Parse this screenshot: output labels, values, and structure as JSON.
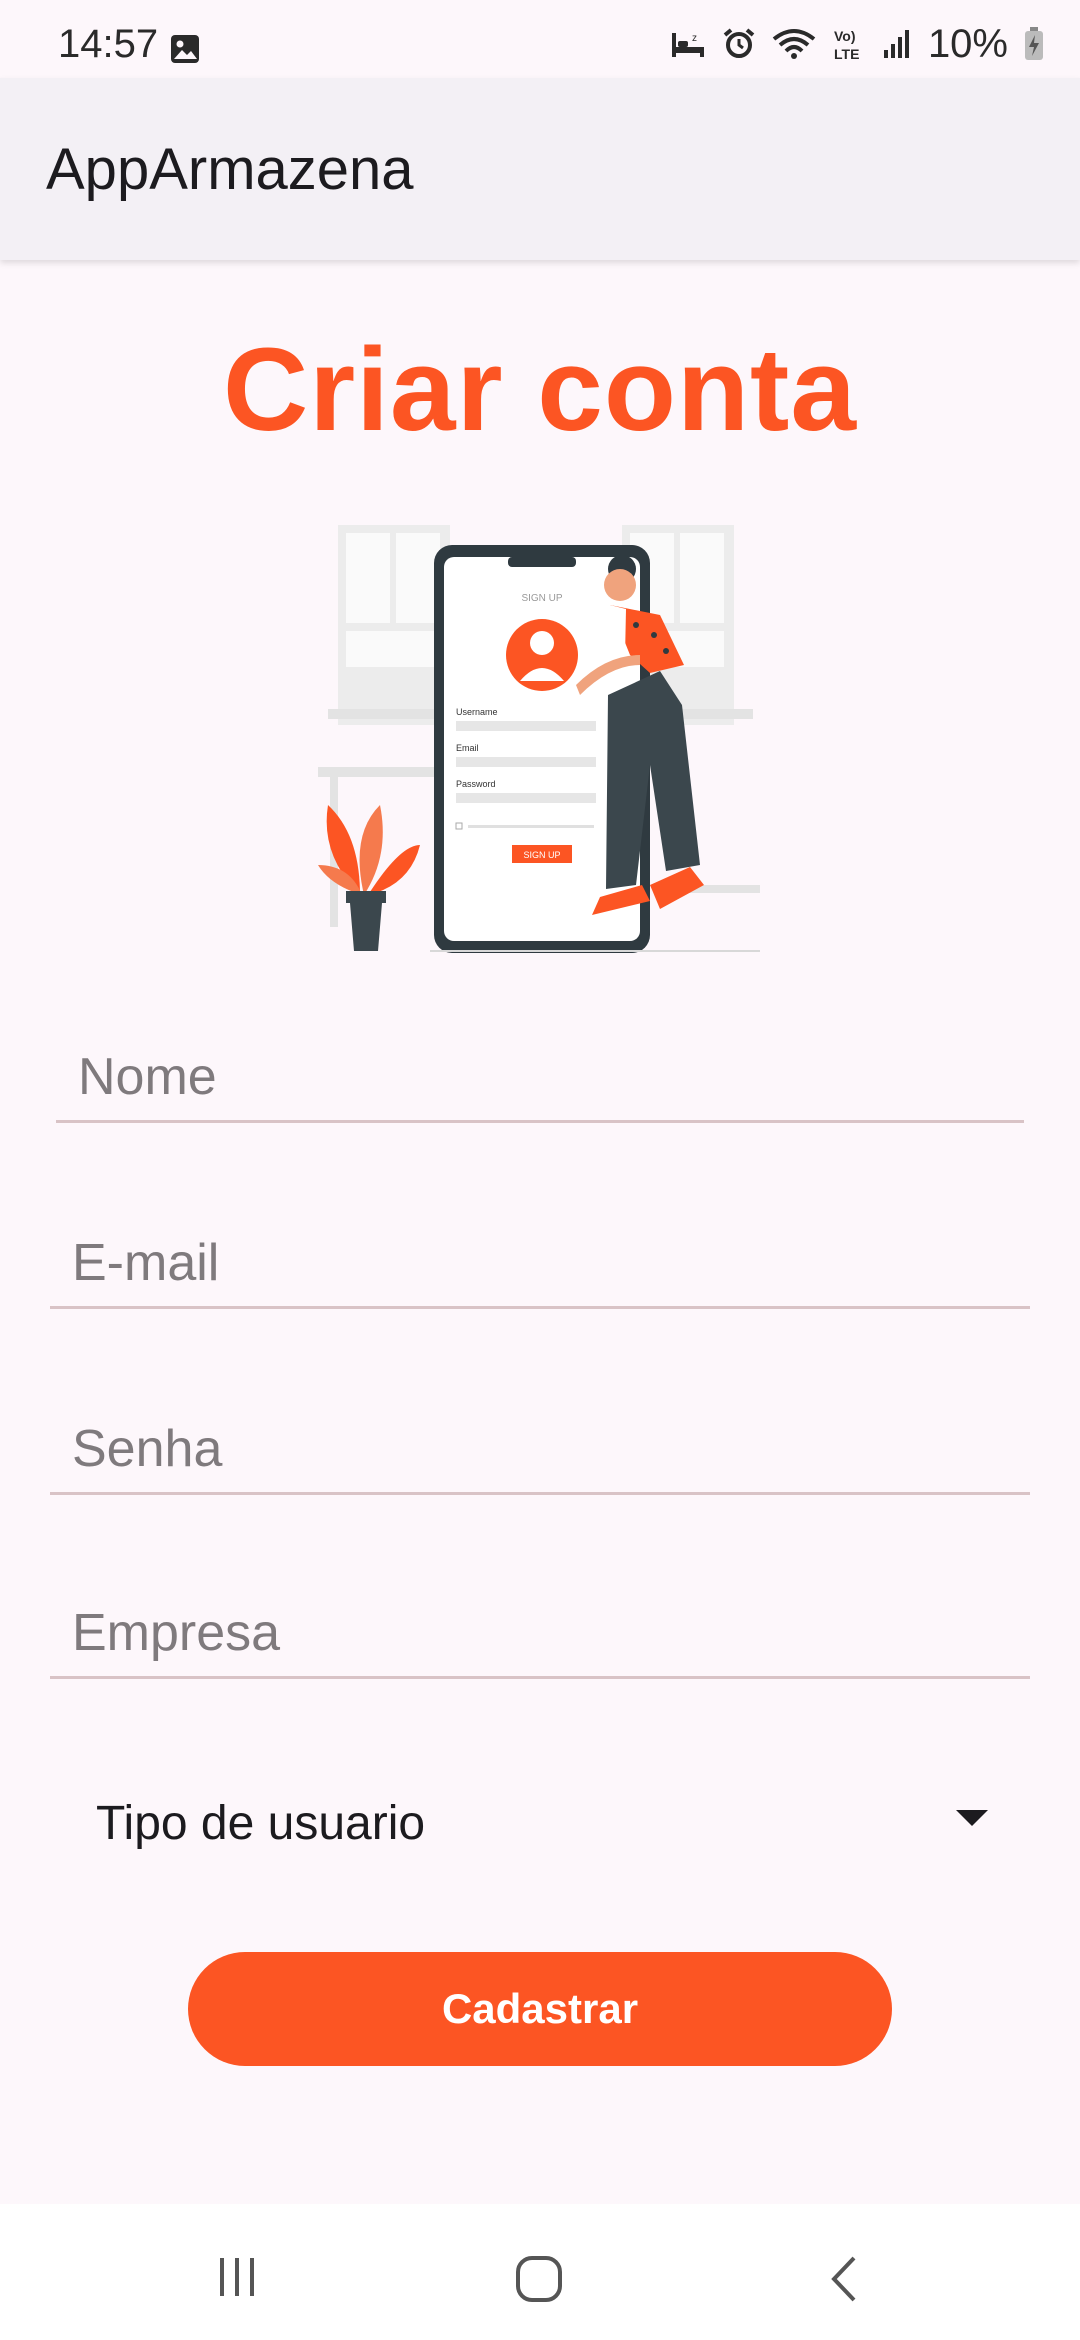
{
  "status_bar": {
    "time": "14:57",
    "battery": "10%",
    "icons": [
      "image-icon",
      "sleep-icon",
      "alarm-icon",
      "wifi-icon",
      "volte-icon",
      "signal-icon",
      "battery-charging-icon"
    ]
  },
  "app_bar": {
    "title": "AppArmazena"
  },
  "page": {
    "heading": "Criar conta"
  },
  "illustration": {
    "icon": "sign-up-illustration",
    "phone_screen_title": "SIGN UP",
    "phone_labels": [
      "Username",
      "Email",
      "Password"
    ],
    "phone_button": "SIGN UP"
  },
  "form": {
    "name_placeholder": "Nome",
    "email_placeholder": "E-mail",
    "password_placeholder": "Senha",
    "company_placeholder": "Empresa",
    "user_type_label": "Tipo de usuario",
    "submit_label": "Cadastrar"
  },
  "nav_bar": {
    "icons": [
      "recent-apps-icon",
      "home-icon",
      "back-icon"
    ]
  },
  "colors": {
    "accent": "#fc5523",
    "background": "#fdf7fb",
    "app_bar": "#f3f0f5"
  }
}
